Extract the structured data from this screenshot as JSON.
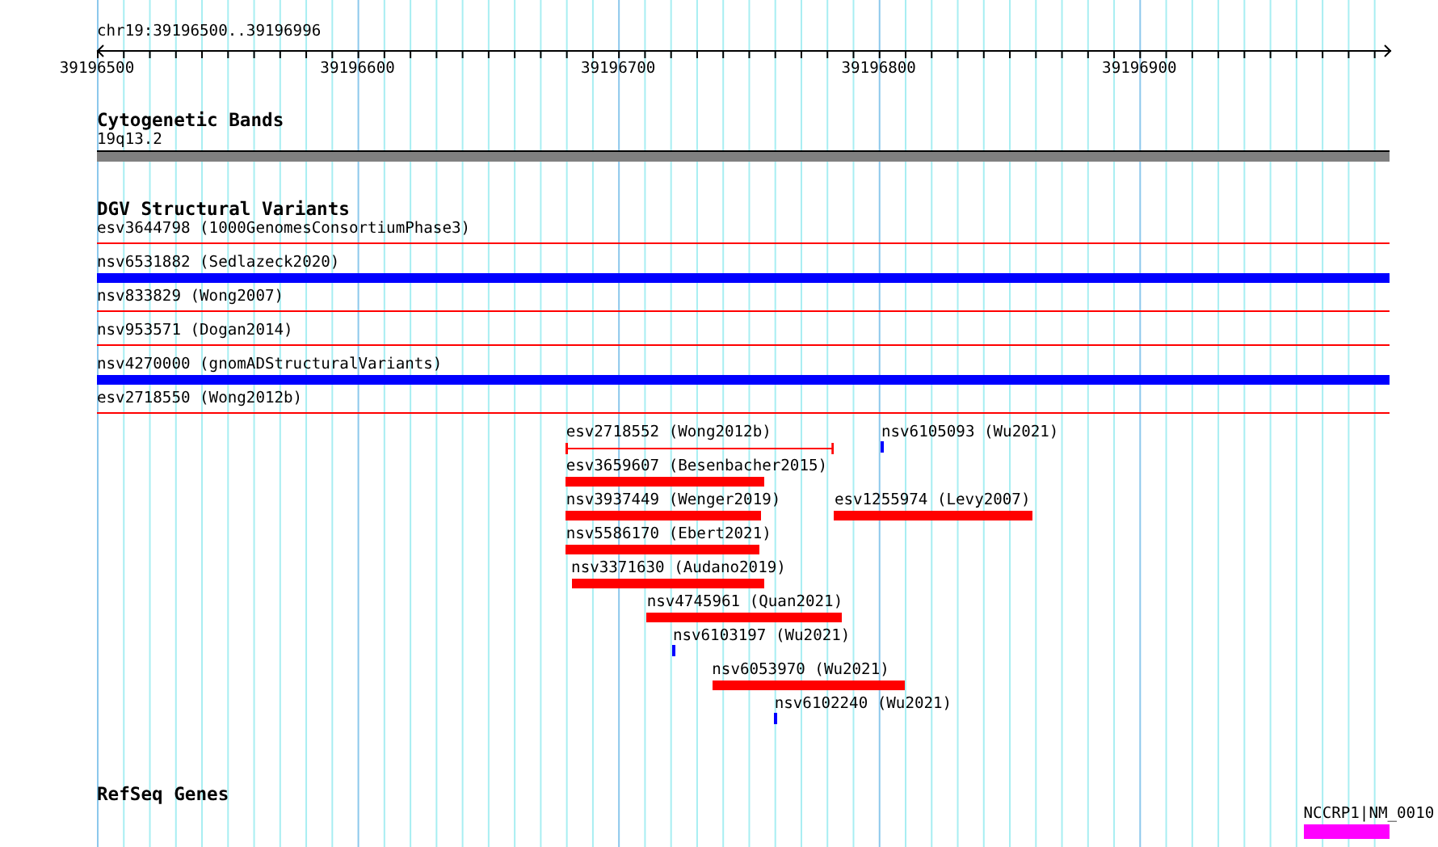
{
  "location": "chr19:39196500..39196996",
  "ruler": {
    "labels": [
      "39196500",
      "39196600",
      "39196700",
      "39196800",
      "39196900"
    ]
  },
  "tracks": [
    {
      "title": "Cytogenetic Bands",
      "rows": [
        {
          "features": [
            {
              "label": "19q13.2",
              "kind": "band",
              "color": "#808080"
            }
          ]
        }
      ]
    },
    {
      "title": "DGV Structural Variants",
      "rows": [
        {
          "features": [
            {
              "label": "esv3644798 (1000GenomesConsortiumPhase3)",
              "kind": "line",
              "color": "#ff0000"
            }
          ]
        },
        {
          "features": [
            {
              "label": "nsv6531882 (Sedlazeck2020)",
              "kind": "bar",
              "color": "#0000ff"
            }
          ]
        },
        {
          "features": [
            {
              "label": "nsv833829 (Wong2007)",
              "kind": "line",
              "color": "#ff0000"
            }
          ]
        },
        {
          "features": [
            {
              "label": "nsv953571 (Dogan2014)",
              "kind": "line",
              "color": "#ff0000"
            }
          ]
        },
        {
          "features": [
            {
              "label": "nsv4270000 (gnomADStructuralVariants)",
              "kind": "bar",
              "color": "#0000ff"
            }
          ]
        },
        {
          "features": [
            {
              "label": "esv2718550 (Wong2012b)",
              "kind": "line",
              "color": "#ff0000"
            }
          ]
        },
        {
          "features": [
            {
              "label": "esv2718552 (Wong2012b)",
              "kind": "span",
              "color": "#ff0000"
            },
            {
              "label": "nsv6105093 (Wu2021)",
              "kind": "tick",
              "color": "#0000ff"
            }
          ]
        },
        {
          "features": [
            {
              "label": "esv3659607 (Besenbacher2015)",
              "kind": "bar",
              "color": "#ff0000"
            }
          ]
        },
        {
          "features": [
            {
              "label": "nsv3937449 (Wenger2019)",
              "kind": "bar",
              "color": "#ff0000"
            },
            {
              "label": "esv1255974 (Levy2007)",
              "kind": "bar",
              "color": "#ff0000"
            }
          ]
        },
        {
          "features": [
            {
              "label": "nsv5586170 (Ebert2021)",
              "kind": "bar",
              "color": "#ff0000"
            }
          ]
        },
        {
          "features": [
            {
              "label": "nsv3371630 (Audano2019)",
              "kind": "bar",
              "color": "#ff0000"
            }
          ]
        },
        {
          "features": [
            {
              "label": "nsv4745961 (Quan2021)",
              "kind": "bar",
              "color": "#ff0000"
            }
          ]
        },
        {
          "features": [
            {
              "label": "nsv6103197 (Wu2021)",
              "kind": "tick",
              "color": "#0000ff"
            }
          ]
        },
        {
          "features": [
            {
              "label": "nsv6053970 (Wu2021)",
              "kind": "bar",
              "color": "#ff0000"
            }
          ]
        },
        {
          "features": [
            {
              "label": "nsv6102240 (Wu2021)",
              "kind": "tick",
              "color": "#0000ff"
            }
          ]
        }
      ]
    },
    {
      "title": "RefSeq Genes",
      "rows": [
        {
          "features": [
            {
              "label": "NCCRP1|NM_0010",
              "kind": "gene",
              "color": "#ff00ff"
            }
          ]
        }
      ]
    }
  ]
}
